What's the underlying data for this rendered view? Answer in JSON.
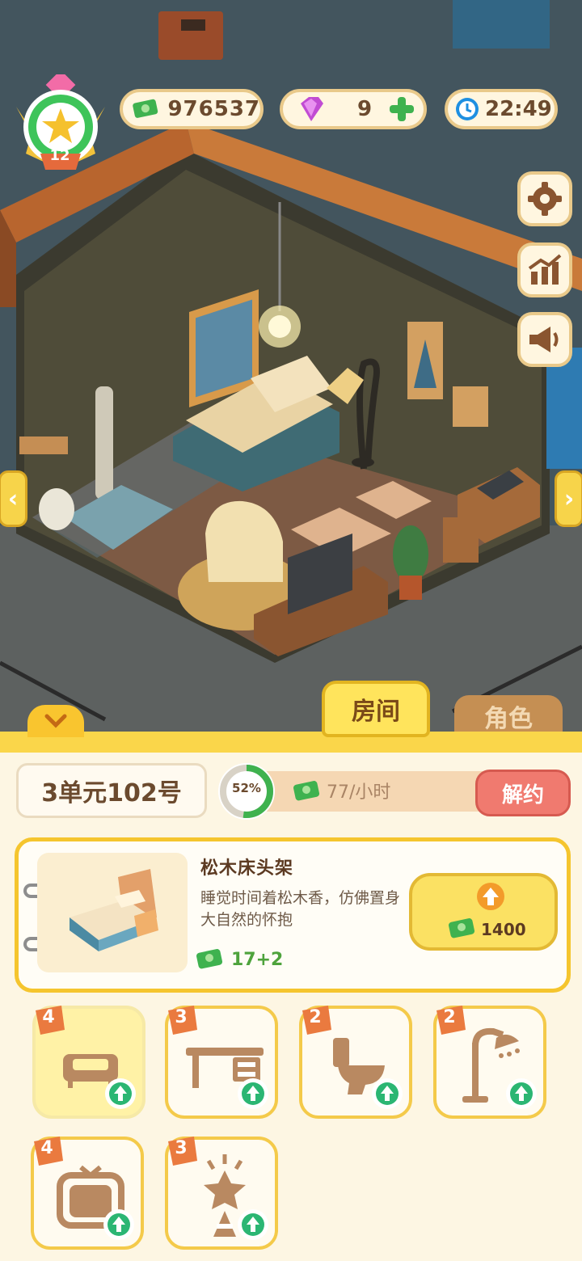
{
  "hud": {
    "level": "12",
    "cash": "976537",
    "gems": "9",
    "clock": "22:49"
  },
  "tabs": {
    "room": "房间",
    "role": "角色"
  },
  "unit": {
    "address": "3单元102号",
    "progress_percent": "52%",
    "progress_value": 0.52,
    "income": "77/小时",
    "cancel_lease": "解约"
  },
  "item": {
    "name": "松木床头架",
    "description": "睡觉时间着松木香，仿佛置身大自然的怀抱",
    "value": "17+2",
    "upgrade_cost": "1400"
  },
  "slots": [
    {
      "level": "4",
      "icon": "bed-icon",
      "selected": true
    },
    {
      "level": "3",
      "icon": "desk-icon",
      "selected": false
    },
    {
      "level": "2",
      "icon": "toilet-icon",
      "selected": false
    },
    {
      "level": "2",
      "icon": "shower-icon",
      "selected": false
    },
    {
      "level": "4",
      "icon": "tv-icon",
      "selected": false
    },
    {
      "level": "3",
      "icon": "lamp-icon",
      "selected": false
    }
  ],
  "colors": {
    "cash_green": "#3fb24f",
    "panel_yellow": "#fad64a",
    "cancel_red": "#f07a6f"
  }
}
